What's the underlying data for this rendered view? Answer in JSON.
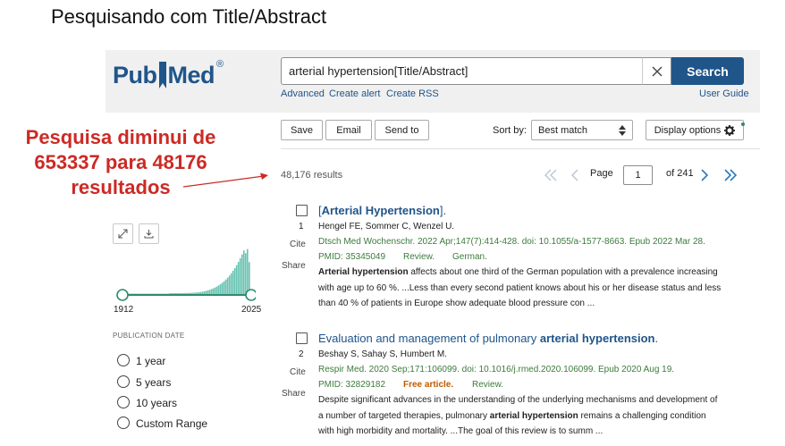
{
  "slide": {
    "title": "Pesquisando com Title/Abstract"
  },
  "logo": {
    "text_pub": "Pub",
    "text_med": "Med",
    "reg": "®"
  },
  "search": {
    "query": "arterial hypertension[Title/Abstract]",
    "button": "Search",
    "clear_glyph": "✕"
  },
  "links": {
    "advanced": "Advanced",
    "create_alert": "Create alert",
    "create_rss": "Create RSS",
    "user_guide": "User Guide"
  },
  "toolbar": {
    "save": "Save",
    "email": "Email",
    "send_to": "Send to",
    "sort_label": "Sort by:",
    "sort_value": "Best match",
    "display_options": "Display options"
  },
  "annotation": {
    "line1": "Pesquisa diminui de",
    "line2": "653337 para 48176",
    "line3": "resultados"
  },
  "results_bar": {
    "count": "48,176 results",
    "page_label": "Page",
    "page_value": "1",
    "of_pages": "of 241"
  },
  "timeline": {
    "start_year": "1912",
    "end_year": "2025",
    "section_label": "PUBLICATION DATE"
  },
  "date_filters": [
    "1 year",
    "5 years",
    "10 years",
    "Custom Range"
  ],
  "results": [
    {
      "num": "1",
      "cite": "Cite",
      "share": "Share",
      "title_link_open": "[",
      "title_bold": "Arterial Hypertension",
      "title_rest": "].",
      "authors": "Hengel FE, Sommer C, Wenzel U.",
      "citation": "Dtsch Med Wochenschr. 2022 Apr;147(7):414-428. doi: 10.1055/a-1577-8663. Epub 2022 Mar 28.",
      "pmid": "PMID: 35345049",
      "type": "Review.",
      "lang": "German.",
      "snippet_l1_bold": "Arterial hypertension",
      "snippet_l1_rest": " affects about one third of the German population with a prevalence increasing",
      "snippet_l2": "with age up to 60 %. ...Less than every second patient knows about his or her disease status and less",
      "snippet_l3": "than 40 % of patients in Europe show adequate blood pressure con ..."
    },
    {
      "num": "2",
      "cite": "Cite",
      "share": "Share",
      "title_plain": "Evaluation and management of pulmonary ",
      "title_bold": "arterial hypertension",
      "title_rest": ".",
      "authors": "Beshay S, Sahay S, Humbert M.",
      "citation": "Respir Med. 2020 Sep;171:106099. doi: 10.1016/j.rmed.2020.106099. Epub 2020 Aug 19.",
      "pmid": "PMID: 32829182",
      "free": "Free article.",
      "type": "Review.",
      "snippet_l1": "Despite significant advances in the understanding of the underlying mechanisms and development of",
      "snippet_l2_pre": "a number of targeted therapies, pulmonary ",
      "snippet_l2_bold": "arterial hypertension",
      "snippet_l2_rest": " remains a challenging condition",
      "snippet_l3": "with high morbidity and mortality. ...The goal of this review is to summ ..."
    }
  ],
  "colors": {
    "brand": "#20558a",
    "annotation": "#cc2a25",
    "citation_green": "#3d7b3d",
    "free_orange": "#c05b00",
    "histogram_teal": "#66c2b0"
  },
  "icons": [
    "expand-icon",
    "download-icon",
    "gear-icon",
    "close-icon",
    "first-page-icon",
    "prev-page-icon",
    "next-page-icon",
    "last-page-icon",
    "sort-arrows-icon"
  ]
}
